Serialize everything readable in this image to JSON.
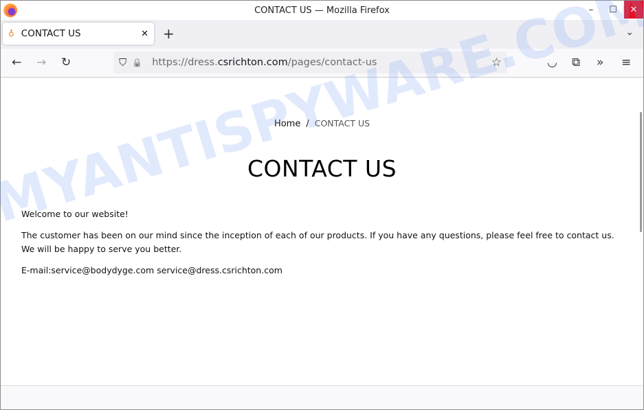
{
  "window": {
    "title": "CONTACT US — Mozilla Firefox",
    "minimize": "–",
    "maximize": "☐",
    "close": "✕"
  },
  "tab": {
    "label": "CONTACT US",
    "close": "✕",
    "new_tab": "+",
    "all_tabs": "⌄"
  },
  "nav": {
    "back": "←",
    "forward": "→",
    "reload": "↻",
    "url_prefix": "https://dress.",
    "url_host": "csrichton.com",
    "url_path": "/pages/contact-us",
    "shield": "⛉",
    "lock": "🔒",
    "star": "☆",
    "pocket": "◡",
    "extensions": "⧉",
    "overflow": "»",
    "menu": "≡"
  },
  "breadcrumb": {
    "home": "Home",
    "sep": "/",
    "current": "CONTACT US"
  },
  "page": {
    "title": "CONTACT US",
    "welcome": "Welcome to our website!",
    "paragraph": "The customer has been on our mind since the inception of each of our products. If you have any questions, please feel free to contact us. We will be happy to serve you better.",
    "email": "E-mail:service@bodydyge.com service@dress.csrichton.com"
  },
  "watermark": "MYANTISPYWARE.COM"
}
